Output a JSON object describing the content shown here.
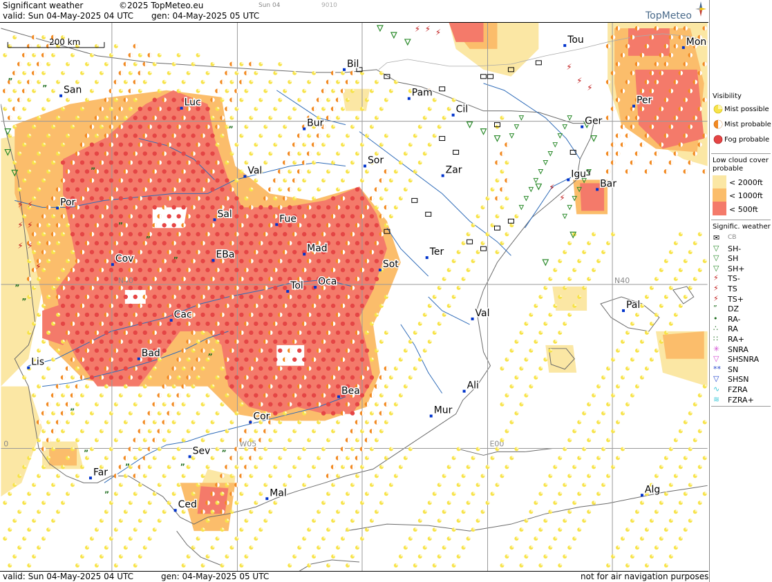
{
  "header": {
    "title": "Significant weather",
    "copyright": "©2025 TopMeteo.eu",
    "frame": "Sun 04",
    "frame_code": "9010",
    "valid": "valid:  Sun  04-May-2025  04 UTC",
    "gen": "gen: 04-May-2025 05 UTC"
  },
  "brand": {
    "name": "TopMeteo"
  },
  "footer": {
    "valid": "valid:  Sun  04-May-2025  04 UTC",
    "gen": "gen: 04-May-2025 05 UTC",
    "disclaimer": "not for air navigation purposes"
  },
  "scale": {
    "label": "200 km"
  },
  "grid_labels": [
    "N40",
    "N40",
    "W05",
    "E00",
    "0"
  ],
  "cities": [
    "Bil",
    "Pam",
    "Tou",
    "Mon",
    "San",
    "Luc",
    "Cil",
    "Per",
    "Bur",
    "Ger",
    "Sor",
    "Zar",
    "Val",
    "Igu",
    "Bar",
    "Por",
    "Sal",
    "Fue",
    "Mad",
    "Ter",
    "Cov",
    "EBa",
    "Sot",
    "Tol",
    "Oca",
    "Pal",
    "Cac",
    "Val",
    "Bad",
    "Lis",
    "Bea",
    "Ali",
    "Mur",
    "Cor",
    "Sev",
    "Far",
    "Mal",
    "Ced",
    "Alg"
  ],
  "legend": {
    "visibility": {
      "title": "Visibility",
      "items": [
        "Mist possible",
        "Mist probable",
        "Fog probable"
      ]
    },
    "cloud": {
      "title": "Low cloud cover probable",
      "items": [
        "< 2000ft",
        "< 1000ft",
        "<  500ft"
      ]
    },
    "weather": {
      "title": "Signific. weather",
      "items": [
        "CB",
        "SH-",
        "SH",
        "SH+",
        "TS-",
        "TS",
        "TS+",
        "DZ",
        "RA-",
        "RA",
        "RA+",
        "SNRA",
        "SHSNRA",
        "SN",
        "SHSN",
        "FZRA",
        "FZRA+"
      ]
    }
  },
  "colors": {
    "fog": "#e54545",
    "zone_fog": "#f47a6a",
    "zone_mist": "#fbbd6b",
    "zone_low": "#fbe7a4",
    "mist_possible": "#f7e34a",
    "mist_probable": "#f28a22",
    "river": "#2e6bb8",
    "coast": "#666666",
    "grid": "#999999",
    "city": "#0033cc",
    "shower": "#2a8a2a",
    "thunder": "#c01b1b",
    "snow": "#d24bd2"
  }
}
